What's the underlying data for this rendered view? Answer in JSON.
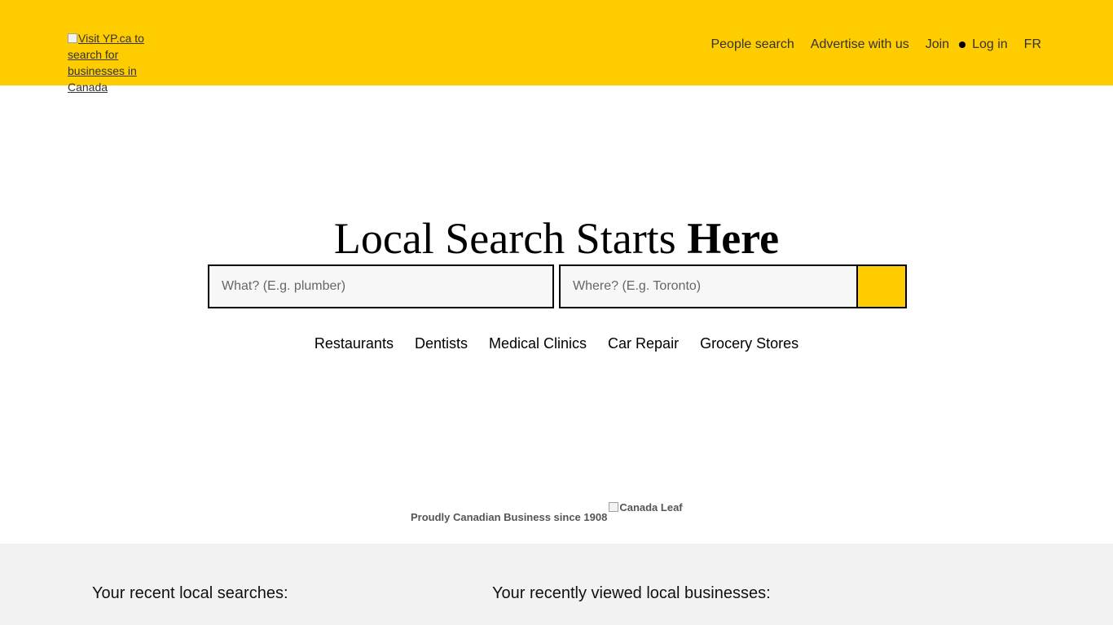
{
  "header": {
    "logo_alt": "Visit YP.ca to search for businesses in Canada",
    "nav": {
      "people_search": "People search",
      "advertise": "Advertise with us",
      "join": "Join",
      "login": "Log in",
      "language": "FR"
    },
    "background_color": "#ffcc00"
  },
  "hero": {
    "title_regular": "Local Search Starts ",
    "title_bold": "Here"
  },
  "search": {
    "what_placeholder": "What? (E.g. plumber)",
    "what_value": "",
    "where_placeholder": "Where? (E.g. Toronto)",
    "where_value": "",
    "button_icon": "search-icon",
    "button_color": "#ffcc00"
  },
  "quick_links": [
    "Restaurants",
    "Dentists",
    "Medical Clinics",
    "Car Repair",
    "Grocery Stores"
  ],
  "proud": {
    "text": "Proudly Canadian Business since 1908",
    "leaf_alt": "Canada Leaf"
  },
  "recent": {
    "searches_title": "Your recent local searches:",
    "businesses_title": "Your recently viewed local businesses:"
  }
}
